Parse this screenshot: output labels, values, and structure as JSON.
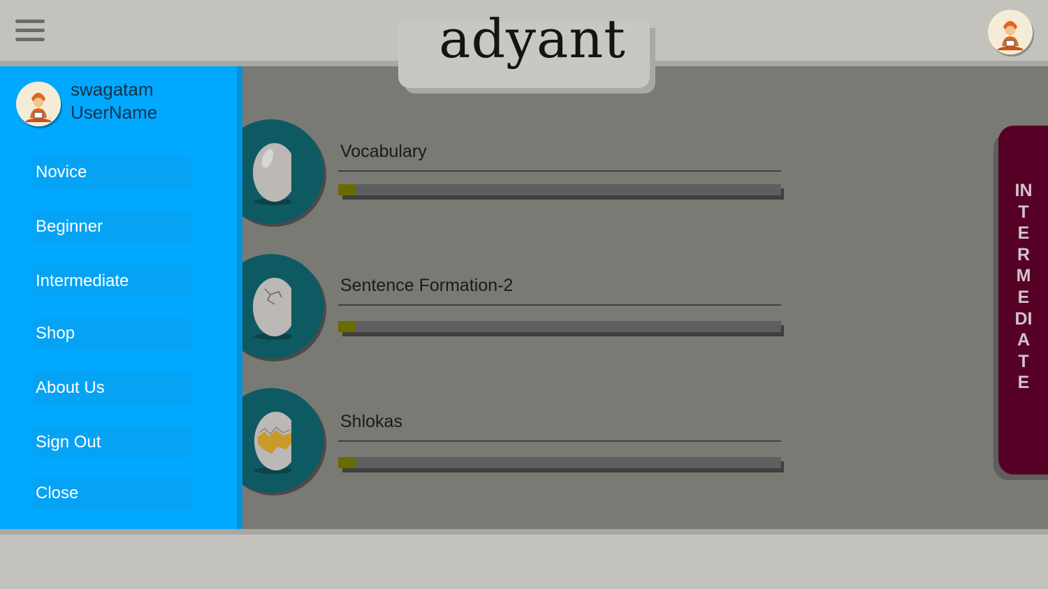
{
  "header": {
    "logo_text": "adyant",
    "menu_icon": "hamburger-menu-icon",
    "avatar_icon": "yogi-laptop-avatar-icon"
  },
  "sidebar": {
    "user_name_line1": "swagatam",
    "user_name_line2": "UserName",
    "items": [
      {
        "label": "Novice"
      },
      {
        "label": "Beginner"
      },
      {
        "label": "Intermediate"
      },
      {
        "label": "Shop"
      },
      {
        "label": "About Us"
      },
      {
        "label": "Sign Out"
      },
      {
        "label": "Close"
      }
    ]
  },
  "lessons": [
    {
      "title": "Vocabulary",
      "icon": "whole-egg-icon",
      "progress": 0.04
    },
    {
      "title": "Sentence Formation-2",
      "icon": "cracked-egg-icon",
      "progress": 0.04
    },
    {
      "title": "Shlokas",
      "icon": "hatching-egg-icon",
      "progress": 0.04
    }
  ],
  "level_tab": {
    "label": "INTERMEDIATE"
  },
  "colors": {
    "sidebar": "#00a8ff",
    "level_tab": "#560026",
    "egg_circle": "#0e5a63",
    "progress_fill": "#6b6a00"
  }
}
